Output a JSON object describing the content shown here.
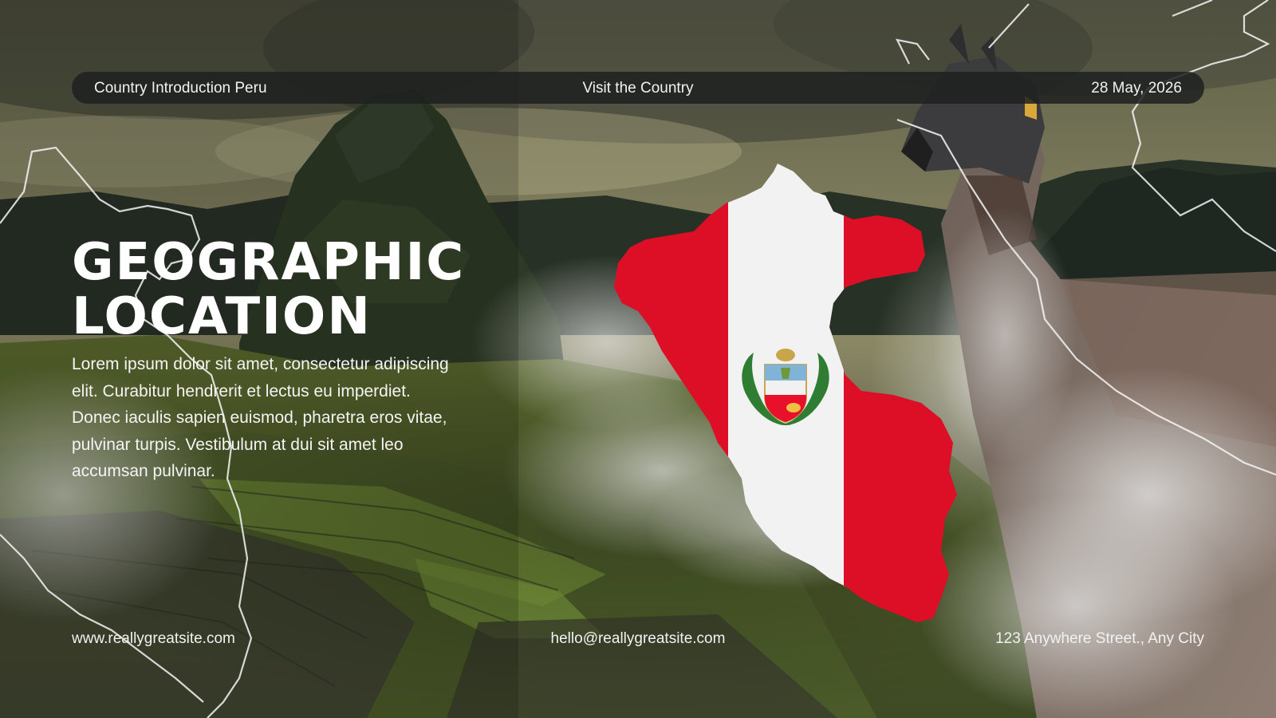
{
  "header": {
    "left_text": "Country Introduction Peru",
    "center_text": "Visit the Country",
    "right_text": "28  May, 2026"
  },
  "content": {
    "title_line1": "GEOGRAPHIC",
    "title_line2": "LOCATION",
    "body": "Lorem ipsum dolor sit amet, consectetur adipiscing elit. Curabitur hendrerit et lectus eu imperdiet. Donec iaculis sapien euismod, pharetra eros vitae, pulvinar turpis. Vestibulum at dui sit amet leo accumsan pulvinar."
  },
  "footer": {
    "website": "www.reallygreatsite.com",
    "email": "hello@reallygreatsite.com",
    "address": "123 Anywhere Street., Any City"
  },
  "colors": {
    "flag_red": "#e8102a",
    "flag_white": "#ffffff",
    "bar_background": "#1e2121",
    "text": "#ffffff"
  },
  "icons": {
    "map": "peru-map-flag-icon",
    "emblem": "peru-coat-of-arms-icon"
  }
}
